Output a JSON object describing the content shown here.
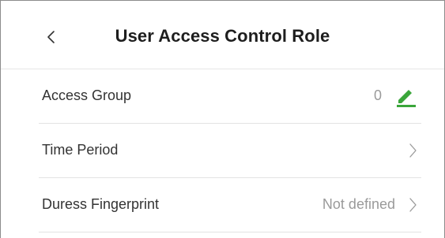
{
  "header": {
    "title": "User Access Control Role",
    "back_icon": "chevron-left-icon"
  },
  "rows": [
    {
      "label": "Access Group",
      "value": "0",
      "icon": "edit-pencil-icon",
      "icon_color": "#3aa63a"
    },
    {
      "label": "Time Period",
      "value": "",
      "icon": "chevron-right-icon"
    },
    {
      "label": "Duress Fingerprint",
      "value": "Not defined",
      "icon": "chevron-right-icon"
    }
  ],
  "colors": {
    "text_primary": "#333333",
    "text_secondary": "#9a9a9a",
    "accent_green": "#3aa63a",
    "divider": "#e3e3e3"
  }
}
